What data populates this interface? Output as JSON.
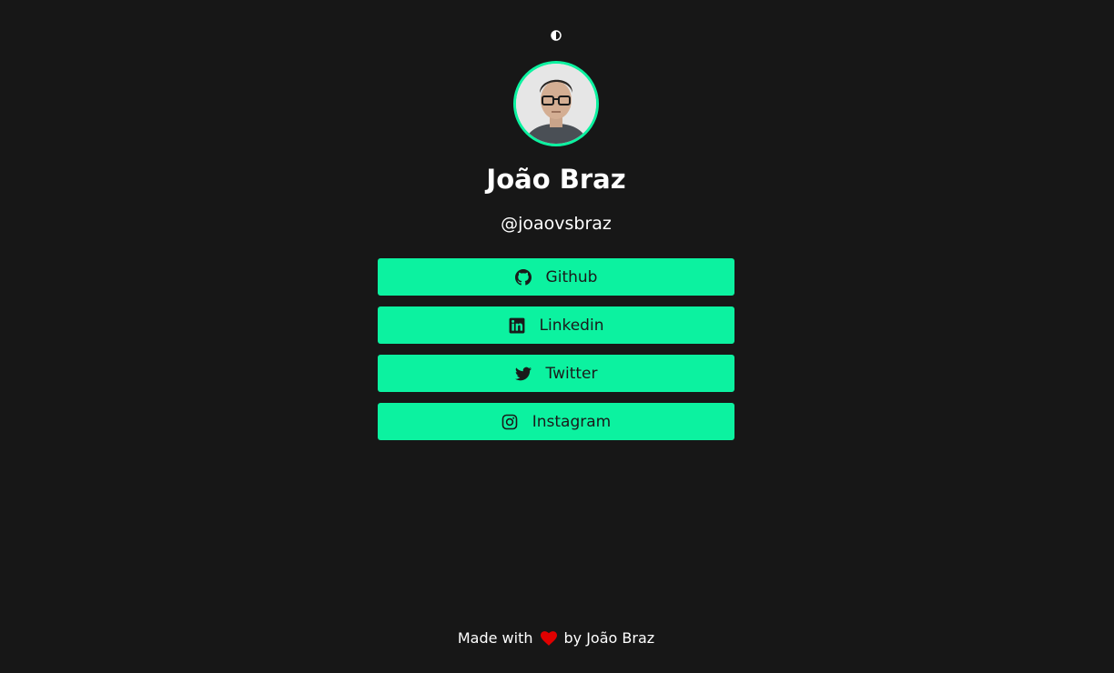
{
  "profile": {
    "name": "João Braz",
    "handle": "@joaovsbraz"
  },
  "links": [
    {
      "label": "Github",
      "icon": "github-icon"
    },
    {
      "label": "Linkedin",
      "icon": "linkedin-icon"
    },
    {
      "label": "Twitter",
      "icon": "twitter-icon"
    },
    {
      "label": "Instagram",
      "icon": "instagram-icon"
    }
  ],
  "footer": {
    "prefix": "Made with",
    "suffix": "by João Braz",
    "icon": "heart-icon"
  },
  "colors": {
    "background": "#171717",
    "accent": "#0cf2a0",
    "heart": "#e00000",
    "text": "#ffffff",
    "button_text": "#1a1a1a"
  },
  "toggle": {
    "icon": "contrast-icon"
  }
}
